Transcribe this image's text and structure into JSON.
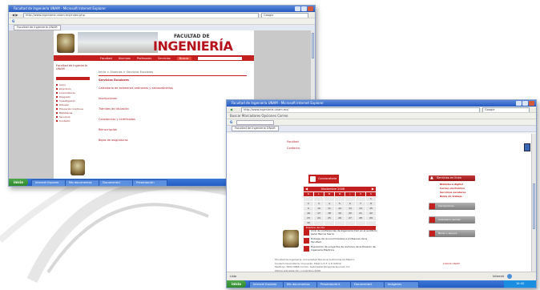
{
  "win1": {
    "title": "Facultad de Ingeniería UNAM - Microsoft Internet Explorer",
    "address": "http://www.ingenieria.unam.mx/index.php",
    "search_placeholder": "Google",
    "tab_label": "Facultad de Ingeniería UNAM",
    "site": {
      "header_small": "FACULTAD DE",
      "header_big": "INGENIERÍA",
      "nav": [
        "Facultad",
        "Alumnos",
        "Profesores",
        "Servicios",
        "Buscar"
      ],
      "left_title": "Facultad de Ingeniería UNAM",
      "left_links": [
        "Inicio",
        "Directorio",
        "Licenciaturas",
        "Posgrado",
        "Investigación",
        "Difusión",
        "Educación Continua",
        "Bibliotecas",
        "Servicios",
        "Contacto"
      ],
      "breadcrumb": "Inicio > Alumnos > Servicios Escolares",
      "section_title": "Servicios Escolares",
      "items": [
        "Calendario de exámenes ordinarios y extraordinarios",
        "Inscripciones",
        "Trámites de titulación",
        "Constancias y certificados",
        "Reinscripción",
        "Bajas de asignaturas"
      ]
    },
    "taskbar": {
      "start": "inicio",
      "buttons": [
        "Internet Explorer",
        "Mis documentos",
        "Documento1",
        "Presentación"
      ],
      "clock": "10:42"
    }
  },
  "win2": {
    "title": "Facultad de Ingeniería UNAM - Microsoft Internet Explorer",
    "address": "http://www.ingenieria.unam.mx/",
    "search_placeholder": "Google",
    "toolbar_text": "Buscar  Marcadores  Opciones  Correo",
    "tab_label": "Facultad de Ingeniería UNAM",
    "links_top": [
      "Facultad",
      "Contacto"
    ],
    "banner_label": "Convocatoria",
    "calendar": {
      "month": "Noviembre 2008",
      "weekdays": [
        "D",
        "L",
        "M",
        "M",
        "J",
        "V",
        "S"
      ],
      "weeks": [
        [
          "",
          "",
          "",
          "",
          "",
          "",
          "1"
        ],
        [
          "2",
          "3",
          "4",
          "5",
          "6",
          "7",
          "8"
        ],
        [
          "9",
          "10",
          "11",
          "12",
          "13",
          "14",
          "15"
        ],
        [
          "16",
          "17",
          "18",
          "19",
          "20",
          "21",
          "22"
        ],
        [
          "23",
          "24",
          "25",
          "26",
          "27",
          "28",
          "29"
        ],
        [
          "30",
          "",
          "",
          "",
          "",
          "",
          ""
        ]
      ],
      "footer": "Eventos del día"
    },
    "news": [
      "Ciclo de conferencias de Ingeniería Civil en el auditorio Javier Barros Sierra",
      "Entrega de reconocimientos a profesores de la Facultad",
      "Exposición de proyectos de alumnos de la División de Ingeniería Eléctrica"
    ],
    "right_panel": {
      "title": "Servicios en línea",
      "links": [
        "Biblioteca digital",
        "Correo electrónico",
        "Servicios escolares",
        "Bolsa de trabajo"
      ],
      "buttons": [
        "Inscripciones",
        "Calendario escolar",
        "Becas y apoyos"
      ]
    },
    "footer_lines": [
      "Facultad de Ingeniería, Universidad Nacional Autónoma de México",
      "Ciudad Universitaria, Coyoacán, México D.F. C.P. 04510",
      "Teléfono: 5622-0866  Correo: webmaster@ingenieria.unam.mx",
      "Última actualización: noviembre 2008"
    ],
    "footer_link": "LOGOS UNAM",
    "status": "Listo",
    "zone": "Internet",
    "taskbar": {
      "start": "inicio",
      "buttons": [
        "Internet Explorer",
        "Mis documentos",
        "Presentación1",
        "Documento2",
        "Imágenes"
      ],
      "clock": "10:45"
    }
  },
  "colors": {
    "brand_red": "#c41f1f",
    "xp_blue": "#2458c0",
    "start_green": "#3a9a37"
  }
}
